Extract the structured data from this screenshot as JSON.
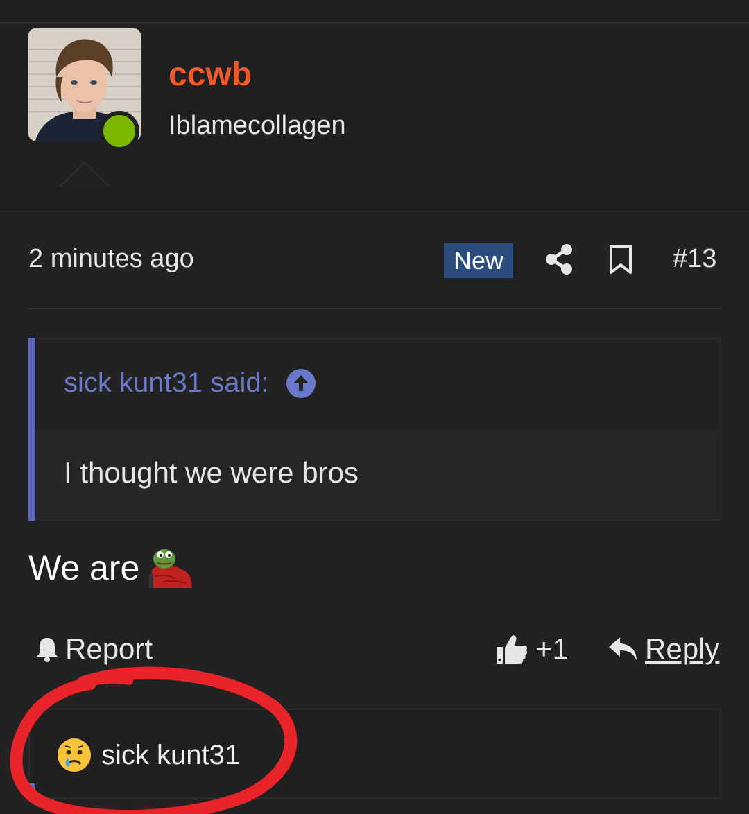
{
  "user": {
    "name": "ccwb",
    "title": "Iblamecollagen",
    "online": true
  },
  "post": {
    "time": "2 minutes ago",
    "badge": "New",
    "number": "#13",
    "message": "We are"
  },
  "quote": {
    "author_line": "sick kunt31 said:",
    "text": "I thought we were bros"
  },
  "actions": {
    "report_label": "Report",
    "like_count": "+1",
    "reply_label": "Reply"
  },
  "reactions": {
    "user": "sick kunt31",
    "emoji": "sad-crying-emoji"
  },
  "colors": {
    "username": "#f1592a",
    "online_dot": "#7ab800",
    "new_badge_bg": "#2b4c7e",
    "quote_accent": "#5b67b8",
    "annotation_circle": "#e8232a"
  }
}
